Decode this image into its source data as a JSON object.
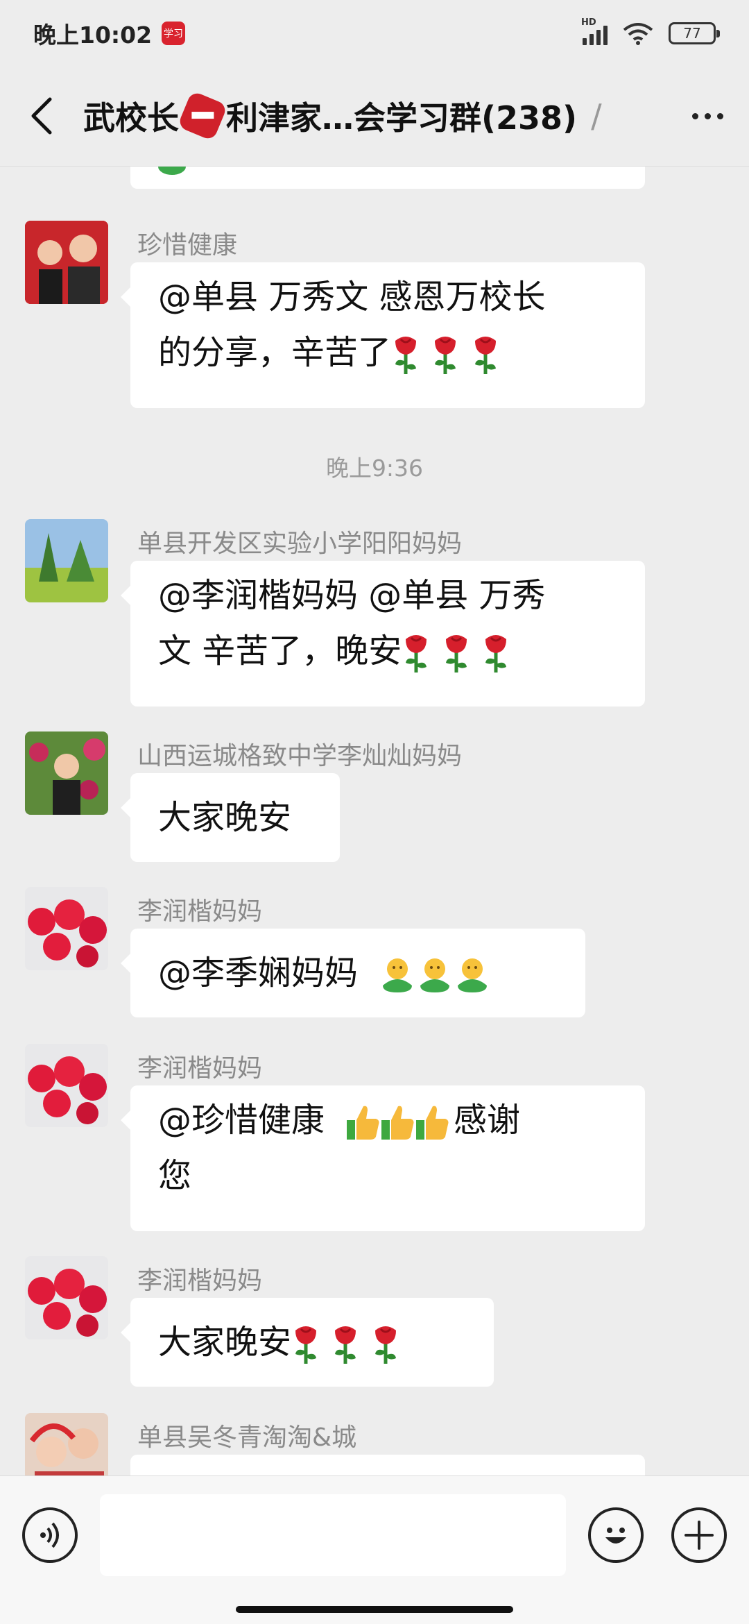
{
  "status": {
    "time": "晚上10:02",
    "app_badge_text": "学习",
    "network_label": "HD",
    "battery": "77"
  },
  "nav": {
    "title_part1": "武校长",
    "title_part2": "利津家…会学习群(238)",
    "title_truncation": "/"
  },
  "messages": [
    {
      "sender": "珍惜健康",
      "text_line1": "@单县  万秀文  感恩万校长",
      "text_line2": "的分享，辛苦了",
      "emoji": "rose",
      "emoji_count": 3
    },
    {
      "divider": "晚上9:36"
    },
    {
      "sender": "单县开发区实验小学阳阳妈妈",
      "text_line1": "@李润楷妈妈  @单县  万秀",
      "text_line2": "文  辛苦了，晚安",
      "emoji": "rose",
      "emoji_count": 3
    },
    {
      "sender": "山西运城格致中学李灿灿妈妈",
      "text_line1": "大家晚安"
    },
    {
      "sender": "李润楷妈妈",
      "text_line1": "@李季娴妈妈",
      "emoji": "hug",
      "emoji_count": 3
    },
    {
      "sender": "李润楷妈妈",
      "text_line1": "@珍惜健康",
      "text_after_emoji": "感谢",
      "text_line2": "您",
      "emoji": "thumbs-up",
      "emoji_count": 3
    },
    {
      "sender": "李润楷妈妈",
      "text_line1": "大家晚安",
      "emoji": "rose",
      "emoji_count": 3
    },
    {
      "sender": "单县吴冬青淘淘&城"
    }
  ],
  "input": {
    "placeholder": ""
  },
  "colors": {
    "background": "#ededed",
    "bubble": "#ffffff",
    "sender": "#8a8a8a",
    "stop_red": "#d0212b"
  }
}
